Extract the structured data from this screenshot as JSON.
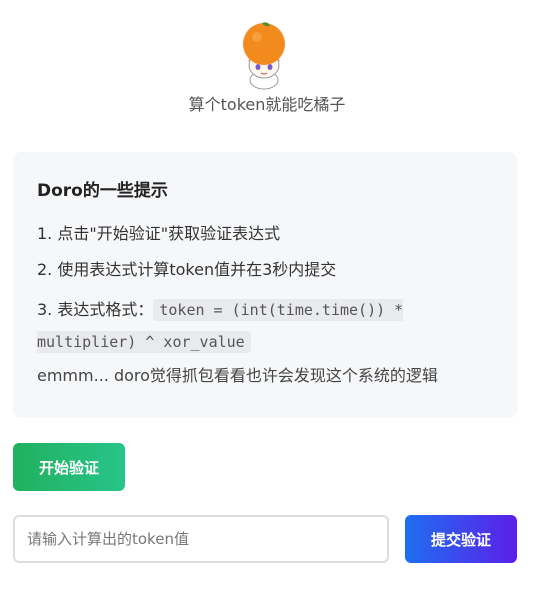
{
  "header": {
    "avatar_icon": "orange-head-character-icon",
    "subtitle": "算个token就能吃橘子"
  },
  "tips": {
    "title": "Doro的一些提示",
    "step1": "1. 点击\"开始验证\"获取验证表达式",
    "step2": "2. 使用表达式计算token值并在3秒内提交",
    "step3_label": "3. 表达式格式：",
    "step3_formula": "token = (int(time.time()) * multiplier) ^ xor_value",
    "note": "emmm... doro觉得抓包看看也许会发现这个系统的逻辑"
  },
  "actions": {
    "start_label": "开始验证",
    "token_placeholder": "请输入计算出的token值",
    "token_value": "",
    "submit_label": "提交验证"
  },
  "colors": {
    "start_gradient": [
      "#21b15e",
      "#27c48a"
    ],
    "submit_gradient": [
      "#1f6ff0",
      "#5b1fe9"
    ],
    "card_background": "#f6f7f9"
  }
}
